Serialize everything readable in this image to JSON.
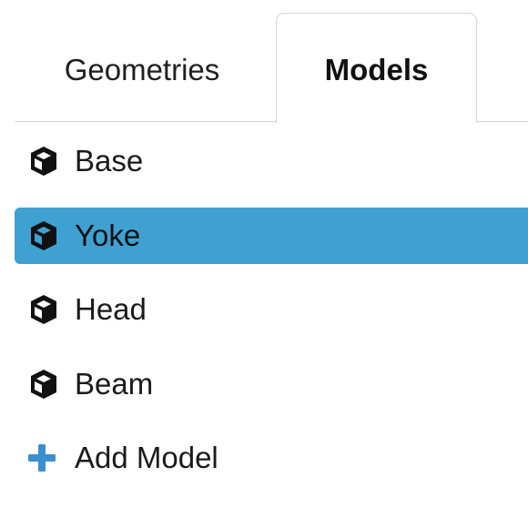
{
  "tabs": [
    {
      "label": "Geometries",
      "active": false
    },
    {
      "label": "Models",
      "active": true
    }
  ],
  "models": [
    {
      "label": "Base",
      "icon": "cube-icon",
      "selected": false
    },
    {
      "label": "Yoke",
      "icon": "cube-icon",
      "selected": true
    },
    {
      "label": "Head",
      "icon": "cube-icon",
      "selected": false
    },
    {
      "label": "Beam",
      "icon": "cube-icon",
      "selected": false
    }
  ],
  "add_model": {
    "label": "Add Model",
    "icon": "plus-icon"
  },
  "colors": {
    "selection": "#3fa0d2",
    "add_icon": "#3a8fd0",
    "border": "#d4d4d4"
  }
}
